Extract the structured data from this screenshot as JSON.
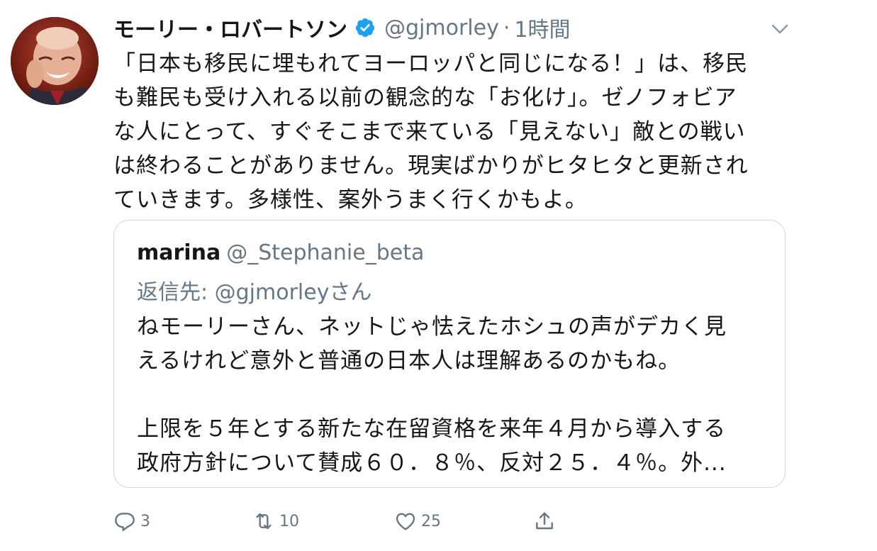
{
  "tweet": {
    "author_name": "モーリー・ロバートソン",
    "handle": "@gjmorley",
    "separator": "·",
    "time": "1時間",
    "lines": [
      "「日本も移民に埋もれてヨーロッパと同じになる！」は、移民",
      "も難民も受け入れる以前の観念的な「お化け」。ゼノフォビア",
      "な人にとって、すぐそこまで来ている「見えない」敵との戦い",
      "は終わることがありません。現実ばかりがヒタヒタと更新され",
      "ていきます。多様性、案外うまく行くかもよ。"
    ]
  },
  "quote": {
    "name": "marina",
    "handle": "@_Stephanie_beta",
    "reply_to": "返信先: @gjmorleyさん",
    "lines": [
      "ねモーリーさん、ネットじゃ怯えたホシュの声がデカく見",
      "えるけれど意外と普通の日本人は理解あるのかもね。",
      "",
      "上限を５年とする新たな在留資格を来年４月から導入する",
      "政府方針について賛成６０．８％、反対２５．４％。外..."
    ]
  },
  "actions": {
    "reply_count": "3",
    "retweet_count": "10",
    "like_count": "25"
  },
  "colors": {
    "verified": "#1da1f2",
    "secondary_text": "#657786",
    "border": "#ccd6dd"
  }
}
